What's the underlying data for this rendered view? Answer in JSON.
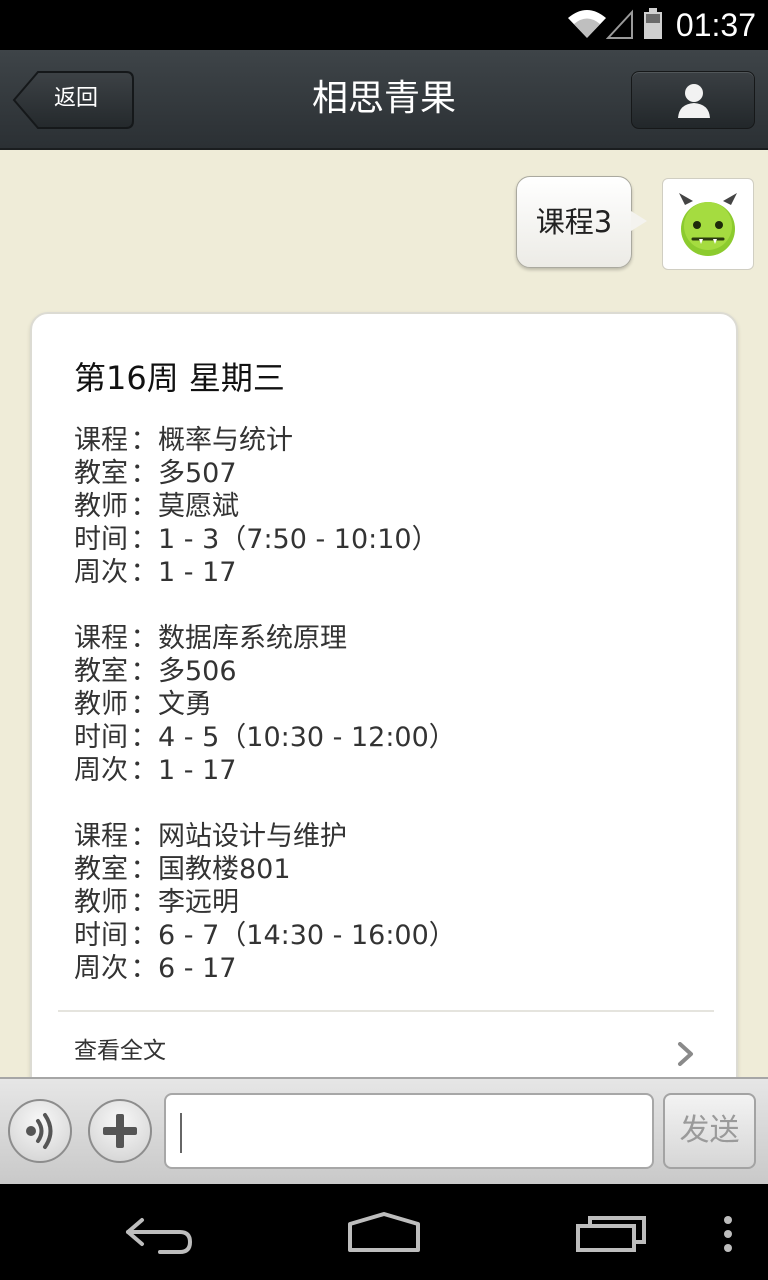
{
  "status_bar": {
    "time": "01:37",
    "icons": [
      "wifi-icon",
      "signal-icon",
      "battery-icon"
    ]
  },
  "header": {
    "back_label": "返回",
    "title": "相思青果",
    "profile_icon": "person-icon"
  },
  "chat": {
    "sent_message": "课程3",
    "avatar_icon": "green-monster-avatar"
  },
  "card": {
    "title": "第16周 星期三",
    "labels": {
      "course": "课程",
      "room": "教室",
      "teacher": "教师",
      "time": "时间",
      "weeks": "周次",
      "separator": "："
    },
    "courses": [
      {
        "course": "概率与统计",
        "room": "多507",
        "teacher": "莫愿斌",
        "time": "1 - 3（7:50 - 10:10）",
        "weeks": "1 - 17"
      },
      {
        "course": "数据库系统原理",
        "room": "多506",
        "teacher": "文勇",
        "time": "4 - 5（10:30 - 12:00）",
        "weeks": "1 - 17"
      },
      {
        "course": "网站设计与维护",
        "room": "国教楼801",
        "teacher": "李远明",
        "time": "6 - 7（14:30 - 16:00）",
        "weeks": "6 - 17"
      }
    ],
    "read_more": "查看全文"
  },
  "input_bar": {
    "text_value": "",
    "send_label": "发送"
  },
  "colors": {
    "background": "#efecd8",
    "header": "#2f3438",
    "card": "#ffffff"
  }
}
